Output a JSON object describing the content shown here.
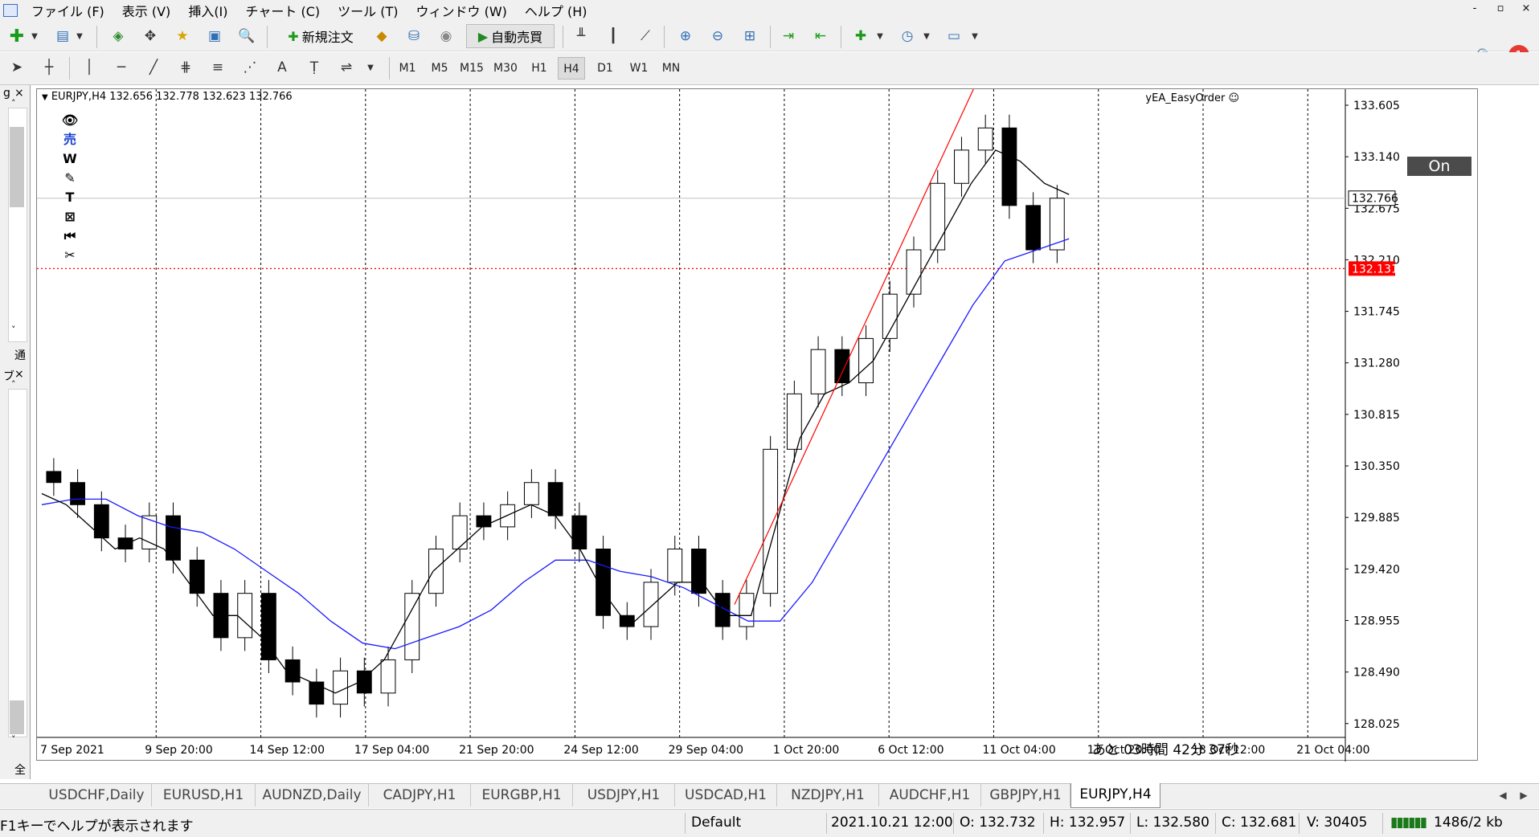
{
  "menubar": {
    "items": [
      "ファイル (F)",
      "表示 (V)",
      "挿入(I)",
      "チャート (C)",
      "ツール (T)",
      "ウィンドウ (W)",
      "ヘルプ (H)"
    ],
    "controls": [
      "-",
      "▫",
      "×"
    ]
  },
  "toolbar": {
    "new_order": "新規注文",
    "auto_trading": "自動売買",
    "notification_count": "1"
  },
  "timeframes": [
    "M1",
    "M5",
    "M15",
    "M30",
    "H1",
    "H4",
    "D1",
    "W1",
    "MN"
  ],
  "active_timeframe": "H4",
  "left_panel": {
    "top_label": "通",
    "bottom_label": "全",
    "top_title": "g",
    "bottom_title": "ブ"
  },
  "chart": {
    "header": "EURJPY,H4  132.656 132.778 132.623 132.766",
    "ea_name": "yEA_EasyOrder ☺",
    "on_button": "On",
    "countdown": "あと 03時間  42分 37秒",
    "price_labels": [
      "133.605",
      "133.140",
      "132.675",
      "132.210",
      "131.745",
      "131.280",
      "130.815",
      "130.350",
      "129.885",
      "129.420",
      "128.955",
      "128.490",
      "128.025"
    ],
    "current_price": "132.766",
    "line_price": "132.131",
    "time_labels": [
      "7 Sep 2021",
      "9 Sep 20:00",
      "14 Sep 12:00",
      "17 Sep 04:00",
      "21 Sep 20:00",
      "24 Sep 12:00",
      "29 Sep 04:00",
      "1 Oct 20:00",
      "6 Oct 12:00",
      "11 Oct 04:00",
      "13 Oct 20:00",
      "18 Oct 12:00",
      "21 Oct 04:00"
    ],
    "colors": {
      "ma_slow": "#1a1aff",
      "ma_fast": "#000000",
      "trendline": "#ff0000",
      "hline": "#ff0000"
    }
  },
  "chart_data": {
    "type": "candlestick",
    "symbol": "EURJPY",
    "timeframe": "H4",
    "ylim": [
      127.9,
      133.75
    ],
    "close_approx": [
      130.2,
      130.0,
      129.7,
      129.6,
      129.9,
      129.5,
      129.2,
      128.8,
      129.2,
      128.6,
      128.4,
      128.2,
      128.5,
      128.3,
      128.6,
      129.2,
      129.6,
      129.9,
      129.8,
      130.0,
      130.2,
      129.9,
      129.6,
      129.0,
      128.9,
      129.3,
      129.6,
      129.2,
      128.9,
      129.2,
      130.5,
      131.0,
      131.4,
      131.1,
      131.5,
      131.9,
      132.3,
      132.9,
      133.2,
      133.4,
      132.7,
      132.3,
      132.766
    ],
    "fast_ma_approx": [
      130.1,
      130.0,
      129.8,
      129.6,
      129.7,
      129.6,
      129.3,
      129.0,
      129.0,
      128.8,
      128.5,
      128.4,
      128.3,
      128.4,
      128.6,
      129.0,
      129.4,
      129.6,
      129.8,
      129.9,
      130.0,
      129.9,
      129.6,
      129.2,
      128.9,
      129.1,
      129.3,
      129.3,
      129.0,
      129.0,
      129.8,
      130.6,
      131.0,
      131.1,
      131.3,
      131.7,
      132.1,
      132.5,
      132.9,
      133.2,
      133.1,
      132.9,
      132.8
    ],
    "slow_ma_approx": [
      130.0,
      130.05,
      130.05,
      129.9,
      129.8,
      129.75,
      129.6,
      129.4,
      129.2,
      128.95,
      128.75,
      128.7,
      128.8,
      128.9,
      129.05,
      129.3,
      129.5,
      129.5,
      129.4,
      129.35,
      129.25,
      129.1,
      128.95,
      128.95,
      129.3,
      129.8,
      130.3,
      130.8,
      131.3,
      131.8,
      132.2,
      132.3,
      132.4
    ]
  },
  "tabs": [
    "USDCHF,Daily",
    "EURUSD,H1",
    "AUDNZD,Daily",
    "CADJPY,H1",
    "EURGBP,H1",
    "USDJPY,H1",
    "USDCAD,H1",
    "NZDJPY,H1",
    "AUDCHF,H1",
    "GBPJPY,H1",
    "EURJPY,H4"
  ],
  "status": {
    "help": "F1キーでヘルプが表示されます",
    "profile": "Default",
    "datetime": "2021.10.21 12:00",
    "open": "O: 132.732",
    "high": "H: 132.957",
    "low": "L: 132.580",
    "close": "C: 132.681",
    "volume": "V: 30405",
    "traffic": "1486/2 kb"
  }
}
